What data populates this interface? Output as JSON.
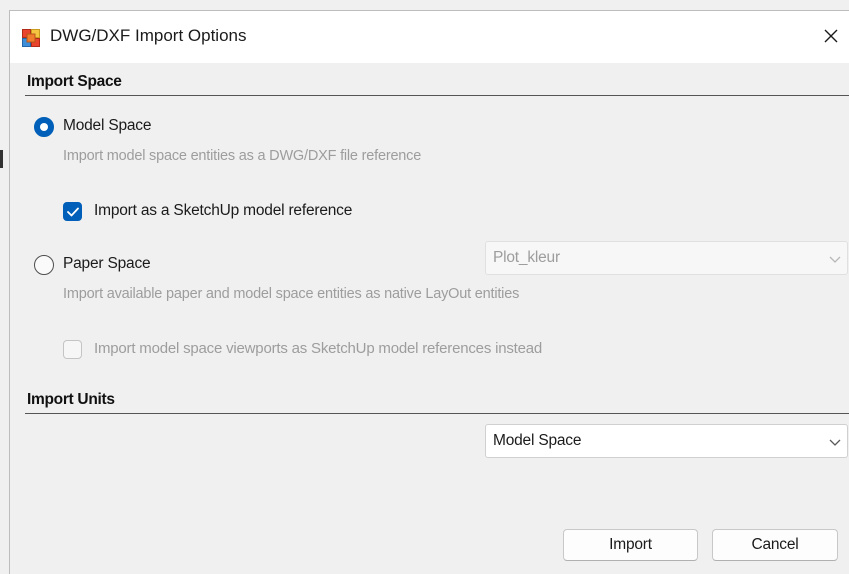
{
  "window": {
    "title": "DWG/DXF Import Options",
    "close_glyph": "✕",
    "app_icon": "app-icon",
    "close_icon": "close-icon"
  },
  "import_space": {
    "header": "Import Space",
    "model_space": {
      "label": "Model Space",
      "selected": true,
      "description": "Import model space entities as a DWG/DXF file reference",
      "checkbox": {
        "label": "Import as a SketchUp model reference",
        "checked": true,
        "enabled": true
      }
    },
    "paper_space": {
      "label": "Paper Space",
      "selected": false,
      "description": "Import available paper and model space entities as native LayOut entities",
      "dropdown_value": "Plot_kleur",
      "dropdown_enabled": false,
      "checkbox": {
        "label": "Import model space viewports as SketchUp model references instead",
        "checked": false,
        "enabled": false
      }
    }
  },
  "import_units": {
    "header": "Import Units",
    "dropdown_value": "Model Space"
  },
  "buttons": {
    "import_label": "Import",
    "cancel_label": "Cancel"
  },
  "colors": {
    "accent": "#005fb8",
    "disabled_text": "#9d9d9d",
    "dialog_background": "#f0f0f0",
    "titlebar_background": "#ffffff"
  }
}
